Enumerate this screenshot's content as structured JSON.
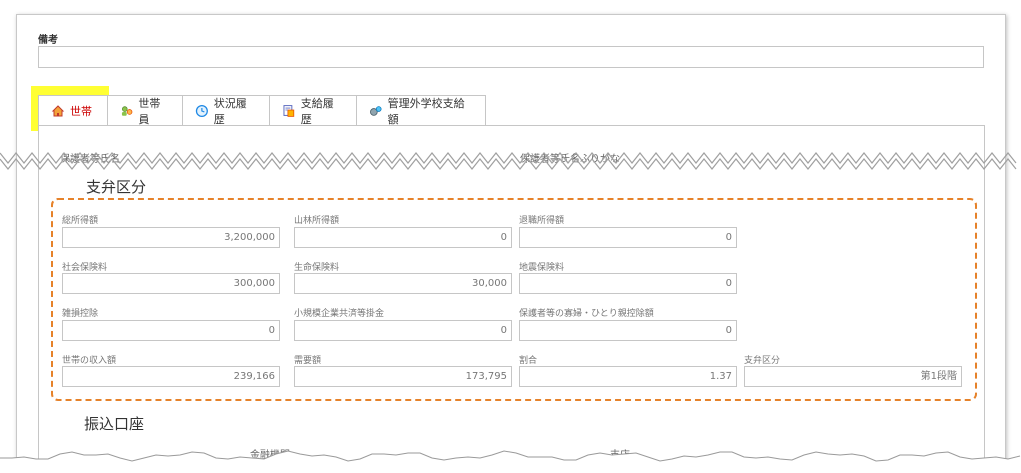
{
  "remarks": {
    "label": "備考",
    "value": ""
  },
  "tabs": [
    {
      "label": "世帯",
      "icon": "house-icon",
      "active": true
    },
    {
      "label": "世帯員",
      "icon": "people-icon"
    },
    {
      "label": "状況履歴",
      "icon": "clock-icon"
    },
    {
      "label": "支給履歴",
      "icon": "document-icon"
    },
    {
      "label": "管理外学校支給額",
      "icon": "gear-person-icon"
    }
  ],
  "cut_labels": {
    "left": "保護者等氏名",
    "right": "保護者等氏名ふりがな"
  },
  "section_payment": {
    "title": "支弁区分",
    "fields": [
      {
        "label": "総所得額",
        "value": "3,200,000"
      },
      {
        "label": "山林所得額",
        "value": "0"
      },
      {
        "label": "退職所得額",
        "value": "0"
      },
      {
        "label": "社会保険料",
        "value": "300,000"
      },
      {
        "label": "生命保険料",
        "value": "30,000"
      },
      {
        "label": "地震保険料",
        "value": "0"
      },
      {
        "label": "雑損控除",
        "value": "0"
      },
      {
        "label": "小規模企業共済等掛金",
        "value": "0"
      },
      {
        "label": "保護者等の寡婦・ひとり親控除額",
        "value": "0"
      },
      {
        "label": "世帯の収入額",
        "value": "239,166"
      },
      {
        "label": "需要額",
        "value": "173,795"
      },
      {
        "label": "割合",
        "value": "1.37"
      },
      {
        "label": "支弁区分",
        "value": "第1段階"
      }
    ]
  },
  "section_bank": {
    "title": "振込口座",
    "cut_labels": {
      "left": "金融機関",
      "right": "支店"
    }
  },
  "colors": {
    "highlight": "#ffff33",
    "dashed_border": "#e6822a",
    "active_tab_text": "#cc0000"
  }
}
